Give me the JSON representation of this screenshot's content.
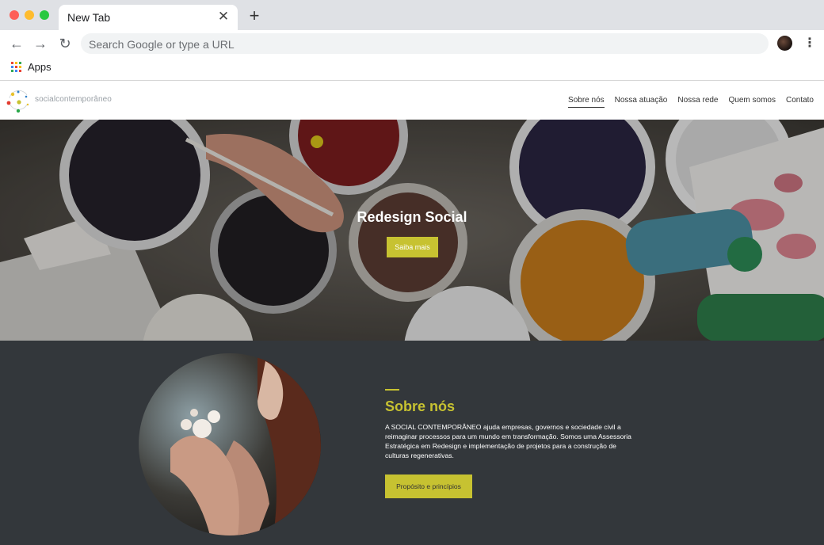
{
  "browser": {
    "tab_title": "New Tab",
    "tab_close_glyph": "✕",
    "new_tab_glyph": "+",
    "back_glyph": "←",
    "forward_glyph": "→",
    "reload_glyph": "↻",
    "menu_glyph": "⋮",
    "omnibox_placeholder": "Search Google or type a URL",
    "bookmarks": {
      "apps_label": "Apps"
    },
    "colors": {
      "titlebar": "#dfe1e5",
      "omnibox": "#f1f3f4"
    }
  },
  "site": {
    "brand": "socialcontemporâneo",
    "nav": {
      "items": [
        {
          "label": "Sobre nós",
          "active": true
        },
        {
          "label": "Nossa atuação",
          "active": false
        },
        {
          "label": "Nossa rede",
          "active": false
        },
        {
          "label": "Quem somos",
          "active": false
        },
        {
          "label": "Contato",
          "active": false
        }
      ]
    },
    "hero": {
      "title": "Redesign Social",
      "button_label": "Saiba mais"
    },
    "about": {
      "title": "Sobre nós",
      "text": "A SOCIAL CONTEMPORÂNEO ajuda empresas, governos e sociedade civil a reimaginar processos para um mundo em transformação. Somos uma Assessoria Estratégica em Redesign e implementação de projetos para a construção de culturas regenerativas.",
      "button_label": "Propósito e princípios"
    },
    "colors": {
      "accent": "#c7c231",
      "dark_section": "#33373b",
      "text_dark": "#333333"
    }
  }
}
